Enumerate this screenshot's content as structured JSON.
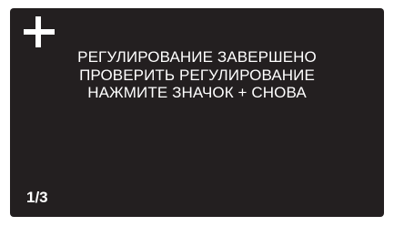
{
  "screen": {
    "background_color": "#231f20",
    "text_color": "#ffffff",
    "icon": "plus-icon",
    "message_lines": [
      "РЕГУЛИРОВАНИЕ ЗАВЕРШЕНО",
      "ПРОВЕРИТЬ РЕГУЛИРОВАНИЕ",
      "НАЖМИТЕ ЗНАЧОК + СНОВА"
    ],
    "page_indicator": "1/3"
  }
}
